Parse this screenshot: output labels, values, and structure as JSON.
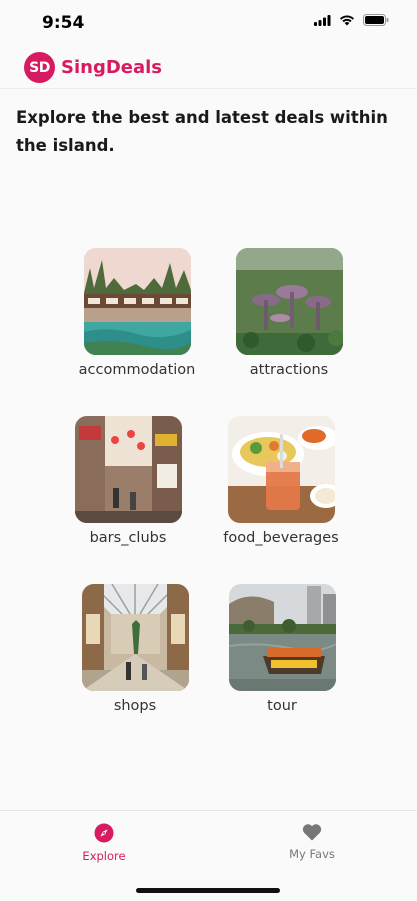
{
  "status_bar": {
    "time": "9:54"
  },
  "header": {
    "logo_text": "SD",
    "title": "SingDeals",
    "brand_color": "#d81b60"
  },
  "intro": {
    "text": "Explore the best and latest deals within the island."
  },
  "categories": [
    {
      "label": "accommodation"
    },
    {
      "label": "attractions"
    },
    {
      "label": "bars_clubs"
    },
    {
      "label": "food_beverages"
    },
    {
      "label": "shops"
    },
    {
      "label": "tour"
    }
  ],
  "bottom_nav": {
    "explore": {
      "label": "Explore",
      "icon": "compass-icon"
    },
    "favs": {
      "label": "My Favs",
      "icon": "heart-icon"
    }
  }
}
